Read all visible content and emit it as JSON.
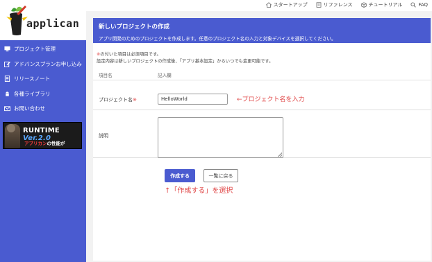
{
  "app": {
    "logo_text": "applican"
  },
  "sidebar": {
    "items": [
      {
        "label": "プロジェクト管理",
        "icon": "monitor-icon"
      },
      {
        "label": "アドバンスプランお申し込み",
        "icon": "edit-icon"
      },
      {
        "label": "リリースノート",
        "icon": "document-icon"
      },
      {
        "label": "各種ライブラリ",
        "icon": "android-icon"
      },
      {
        "label": "お問い合わせ",
        "icon": "mail-icon"
      }
    ],
    "banner": {
      "title": "RUNTIME ",
      "version": "Ver.2.0",
      "tagline_red": "アプリカン",
      "tagline_white": "の性能が UP！！"
    }
  },
  "topbar": {
    "links": [
      {
        "label": "スタートアップ",
        "icon": "home-icon"
      },
      {
        "label": "リファレンス",
        "icon": "book-icon"
      },
      {
        "label": "チュートリアル",
        "icon": "box-icon"
      },
      {
        "label": "FAQ",
        "icon": "search-icon"
      }
    ]
  },
  "panel": {
    "title": "新しいプロジェクトの作成",
    "subtitle": "アプリ開発のためのプロジェクトを作成します。任意のプロジェクト名の入力と対象デバイスを選択してください。",
    "note1_mark": "※",
    "note1": "の付いた項目は必須項目です。",
    "note2": "設定内容は新しいプロジェクトの作成後、「アプリ基本設定」からいつでも変更可能です。",
    "col_item": "項目名",
    "col_entry": "記入欄",
    "name_label": "プロジェクト名",
    "required_mark": "※",
    "name_value": "HelloWorld",
    "desc_label": "説明",
    "desc_value": "",
    "create_button": "作成する",
    "back_button": "一覧に戻る"
  },
  "annotations": {
    "input_hint": "←プロジェクト名を入力",
    "button_hint": "↑「作成する」を選択"
  },
  "colors": {
    "accent": "#4a5bd0",
    "annotation": "#e04848"
  }
}
